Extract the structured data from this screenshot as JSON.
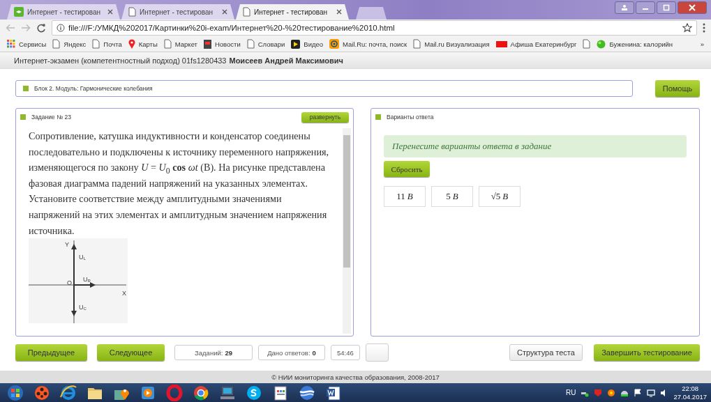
{
  "browser": {
    "tabs": [
      {
        "title": "Интернет - тестирован",
        "kind": "logo",
        "selected": false
      },
      {
        "title": "Интернет - тестирован",
        "kind": "page",
        "selected": false
      },
      {
        "title": "Интернет - тестирован",
        "kind": "page",
        "selected": true
      }
    ],
    "address": "file:///F:/УМКД%202017/Картинки%20i-exam/Интернет%20-%20тестирование%2010.html",
    "bookmarks": [
      {
        "label": "Сервисы",
        "kind": "apps"
      },
      {
        "label": "Яндекс",
        "kind": "page"
      },
      {
        "label": "Почта",
        "kind": "page"
      },
      {
        "label": "Карты",
        "kind": "pin"
      },
      {
        "label": "Маркет",
        "kind": "page"
      },
      {
        "label": "Новости",
        "kind": "news"
      },
      {
        "label": "Словари",
        "kind": "page"
      },
      {
        "label": "Видео",
        "kind": "play"
      },
      {
        "label": "Mail.Ru: почта, поиск",
        "kind": "mail"
      },
      {
        "label": "Mail.ru Визуализация",
        "kind": "page"
      },
      {
        "label": "Афиша Екатеринбург",
        "kind": "badge"
      },
      {
        "kind": "page"
      },
      {
        "label": "Буженина: калорийн",
        "kind": "ball"
      }
    ],
    "more": "»"
  },
  "header": {
    "title": "Интернет-экзамен (компетентностный подход) 01fs1280433",
    "student": "Моисеев Андрей Максимович"
  },
  "block": {
    "title": "Блок 2. Модуль: Гармонические колебания",
    "help": "Помощь"
  },
  "task": {
    "title": "Задание № 23",
    "expand": "развернуть",
    "text": "Сопротивление, катушка индуктивности и конденсатор соединены последовательно и подключены к источнику переменного напряжения, изменяющегося по закону *U* = *U*$_{0}$ **cos** *ωt* (В). На рисунке представлена фазовая диаграмма падений напряжений на указанных элементах. Установите соответствие между амплитудными значениями напряжений на этих элементах и амплитудным значением напряжения источника.",
    "diagram_labels": [
      {
        "text": "Y"
      },
      {
        "text": "U",
        "sub": "L"
      },
      {
        "text": "O"
      },
      {
        "text": "U",
        "sub": "R"
      },
      {
        "text": "X"
      },
      {
        "text": "U",
        "sub": "C"
      }
    ]
  },
  "answers": {
    "title": "Варианты ответа",
    "hint": "Перенесите варианты ответа в задание",
    "reset": "Сбросить",
    "options": [
      {
        "value": "11",
        "unit": "B"
      },
      {
        "value": "5",
        "unit": "B"
      },
      {
        "value": "√5",
        "unit": "B"
      }
    ]
  },
  "nav": {
    "prev": "Предыдущее",
    "next": "Следующее",
    "tasks": "Заданий: **29**",
    "answered": "Дано ответов: **0**",
    "timer": "54:46",
    "structure": "Структура теста",
    "finish": "Завершить тестирование"
  },
  "footer": "© НИИ мониторинга качества образования, 2008-2017",
  "taskbar": {
    "apps": [
      {
        "kind": "start"
      },
      {
        "kind": "reel"
      },
      {
        "kind": "ie"
      },
      {
        "kind": "folder"
      },
      {
        "kind": "maps"
      },
      {
        "kind": "player"
      },
      {
        "kind": "opera"
      },
      {
        "kind": "chrome"
      },
      {
        "kind": "computer"
      },
      {
        "kind": "skype"
      },
      {
        "kind": "calc"
      },
      {
        "kind": "globe"
      },
      {
        "kind": "word"
      }
    ],
    "lang": "RU",
    "time": "22:08",
    "date": "27.04.2017"
  }
}
